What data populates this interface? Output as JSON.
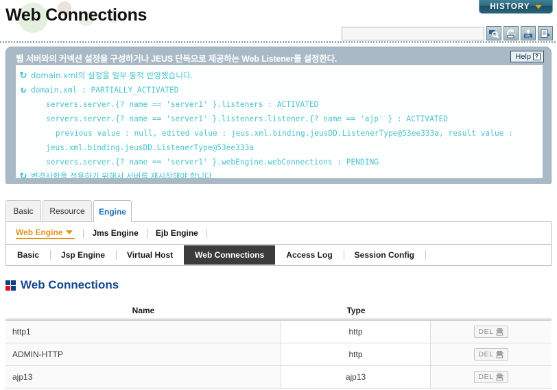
{
  "header": {
    "page_title": "Web Connections",
    "history_label": "HISTORY",
    "history_icon": "chevron-down-icon",
    "search_value": "",
    "search_placeholder": "",
    "tools": [
      {
        "name": "search-icon",
        "title": "Search"
      },
      {
        "name": "refresh-icon",
        "title": "Refresh"
      },
      {
        "name": "xml-export-icon",
        "title": "XML"
      },
      {
        "name": "save-icon",
        "title": "Save"
      }
    ]
  },
  "info_panel": {
    "title": "웹 서버와의 커넥션 설정을 구성하거나 JEUS 단독으로 제공하는 Web Listener를 설정한다.",
    "help_label": "Help",
    "help_icon": "question-icon",
    "log_lines": [
      {
        "icon": "refresh-cycle-icon",
        "indent": 0,
        "korean": true,
        "text": "domain.xml의 설정을 일부 동적 반영했습니다."
      },
      {
        "icon": "refresh-cycle-icon",
        "indent": 0,
        "korean": false,
        "text": "domain.xml : PARTIALLY_ACTIVATED"
      },
      {
        "icon": "",
        "indent": 1,
        "korean": false,
        "text": "servers.server.{? name == 'server1' }.listeners : ACTIVATED"
      },
      {
        "icon": "",
        "indent": 1,
        "korean": false,
        "text": "servers.server.{? name == 'server1' }.listeners.listener.{? name == 'ajp' } : ACTIVATED"
      },
      {
        "icon": "",
        "indent": 2,
        "korean": false,
        "text": "previous value : null, edited value : jeus.xml.binding.jeusDD.ListenerType@53ee333a, result value :"
      },
      {
        "icon": "",
        "indent": 1,
        "korean": false,
        "text": "jeus.xml.binding.jeusDD.ListenerType@53ee333a"
      },
      {
        "icon": "",
        "indent": 1,
        "korean": false,
        "text": "servers.server.{? name == 'server1' }.webEngine.webConnections : PENDING"
      },
      {
        "icon": "refresh-cycle-icon",
        "indent": 0,
        "korean": true,
        "text": "변경사항을 적용하기 위해서 서버를 재시작해야 합니다."
      }
    ]
  },
  "tabs_level1": [
    {
      "label": "Basic",
      "active": false
    },
    {
      "label": "Resource",
      "active": false
    },
    {
      "label": "Engine",
      "active": true
    }
  ],
  "engine_row": [
    {
      "label": "Web Engine",
      "active": true,
      "caret": true
    },
    {
      "label": "Jms Engine",
      "active": false,
      "caret": false
    },
    {
      "label": "Ejb Engine",
      "active": false,
      "caret": false
    }
  ],
  "tabs_level2": [
    {
      "label": "Basic",
      "active": false
    },
    {
      "label": "Jsp Engine",
      "active": false
    },
    {
      "label": "Virtual Host",
      "active": false
    },
    {
      "label": "Web Connections",
      "active": true
    },
    {
      "label": "Access Log",
      "active": false
    },
    {
      "label": "Session Config",
      "active": false
    }
  ],
  "section": {
    "icon": "section-square-icon",
    "title": "Web Connections"
  },
  "table": {
    "columns": [
      "Name",
      "Type",
      ""
    ],
    "delete_label": "DEL",
    "delete_icon": "trash-icon",
    "rows": [
      {
        "name": "http1",
        "type": "http"
      },
      {
        "name": "ADMIN-HTTP",
        "type": "http"
      },
      {
        "name": "ajp13",
        "type": "ajp13"
      }
    ]
  },
  "colors": {
    "accent_blue": "#12468f",
    "accent_orange": "#e2921c",
    "panel_gray": "#a9bac6",
    "log_cyan": "#4bc3cf",
    "active_tab": "#3b3b3b",
    "history_teal": "#2f6a80"
  }
}
